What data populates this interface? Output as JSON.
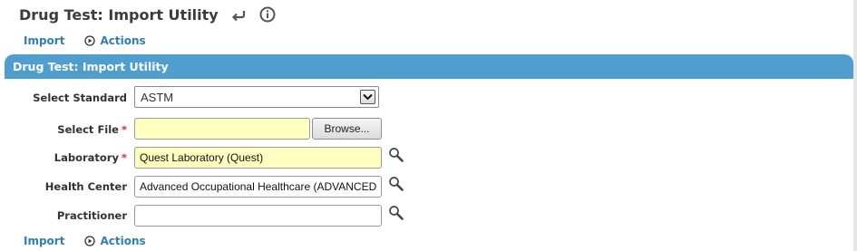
{
  "page": {
    "title": "Drug Test: Import Utility"
  },
  "toolbar": {
    "import_label": "Import",
    "actions_label": "Actions"
  },
  "panel": {
    "title": "Drug Test: Import Utility"
  },
  "form": {
    "standard": {
      "label": "Select Standard",
      "value": "ASTM"
    },
    "file": {
      "label": "Select File",
      "required_mark": "*",
      "value": "",
      "browse_label": "Browse..."
    },
    "laboratory": {
      "label": "Laboratory",
      "required_mark": "*",
      "value": "Quest Laboratory (Quest)"
    },
    "health_center": {
      "label": "Health Center",
      "value": "Advanced Occupational Healthcare (ADVANCED"
    },
    "practitioner": {
      "label": "Practitioner",
      "value": ""
    }
  },
  "colors": {
    "accent": "#4f9ed0",
    "link": "#2f7fb7",
    "required_bg": "#ffffc0",
    "required_mark": "#d32f2f"
  },
  "icons": {
    "back": "back-arrow-icon",
    "info": "info-icon",
    "actions": "play-circle-icon",
    "lookup": "magnifier-icon",
    "dropdown": "chevron-down-icon"
  }
}
